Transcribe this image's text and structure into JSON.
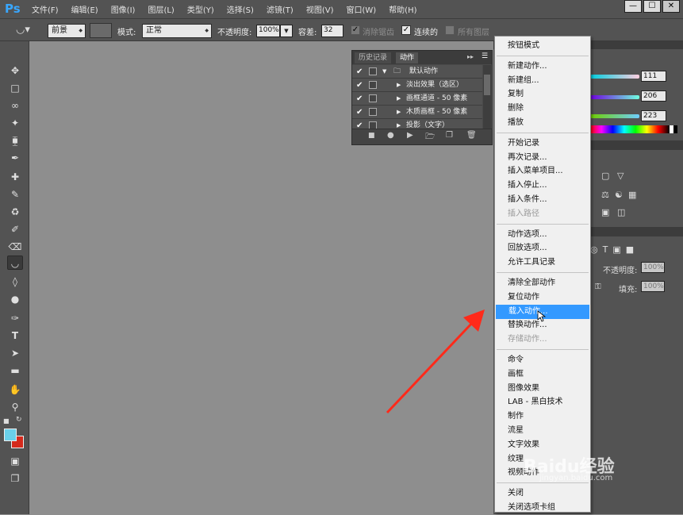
{
  "app": {
    "logo": "Ps"
  },
  "menubar": {
    "items": [
      "文件(F)",
      "编辑(E)",
      "图像(I)",
      "图层(L)",
      "类型(Y)",
      "选择(S)",
      "滤镜(T)",
      "视图(V)",
      "窗口(W)",
      "帮助(H)"
    ],
    "window_controls": {
      "minimize": "—",
      "restore": "☐",
      "close": "✕"
    }
  },
  "options": {
    "fill_source": "前景",
    "mode_label": "模式:",
    "mode_value": "正常",
    "opacity_label": "不透明度:",
    "opacity_value": "100%",
    "tolerance_label": "容差:",
    "tolerance_value": "32",
    "anti_alias_label": "消除锯齿",
    "contiguous_label": "连续的",
    "all_layers_label": "所有图层"
  },
  "actions_panel": {
    "tab_history": "历史记录",
    "tab_actions": "动作",
    "rows": [
      {
        "label": "默认动作",
        "checked": "✔",
        "level": 0
      },
      {
        "label": "淡出效果（选区）",
        "checked": "✔",
        "level": 1
      },
      {
        "label": "画框通道 - 50 像素",
        "checked": "✔",
        "level": 1
      },
      {
        "label": "木质画框 - 50 像素",
        "checked": "✔",
        "level": 1
      },
      {
        "label": "投影（文字）",
        "checked": "✔",
        "level": 1
      }
    ]
  },
  "right_panels": {
    "color_values": [
      "111",
      "206",
      "223"
    ],
    "layers_opacity_label": "不透明度:",
    "layers_opacity_value": "100%",
    "fill_label": "填充:",
    "fill_value": "100%"
  },
  "context_menu": {
    "groups": [
      [
        {
          "label": "按钮模式",
          "state": "normal"
        }
      ],
      [
        {
          "label": "新建动作...",
          "state": "normal"
        },
        {
          "label": "新建组...",
          "state": "normal"
        },
        {
          "label": "复制",
          "state": "normal"
        },
        {
          "label": "删除",
          "state": "normal"
        },
        {
          "label": "播放",
          "state": "normal"
        }
      ],
      [
        {
          "label": "开始记录",
          "state": "normal"
        },
        {
          "label": "再次记录...",
          "state": "normal"
        },
        {
          "label": "插入菜单项目...",
          "state": "normal"
        },
        {
          "label": "插入停止...",
          "state": "normal"
        },
        {
          "label": "插入条件...",
          "state": "normal"
        },
        {
          "label": "插入路径",
          "state": "disabled"
        }
      ],
      [
        {
          "label": "动作选项...",
          "state": "normal"
        },
        {
          "label": "回放选项...",
          "state": "normal"
        },
        {
          "label": "允许工具记录",
          "state": "normal"
        }
      ],
      [
        {
          "label": "清除全部动作",
          "state": "normal"
        },
        {
          "label": "复位动作",
          "state": "normal"
        },
        {
          "label": "载入动作...",
          "state": "highlighted"
        },
        {
          "label": "替换动作...",
          "state": "normal"
        },
        {
          "label": "存储动作...",
          "state": "disabled"
        }
      ],
      [
        {
          "label": "命令",
          "state": "normal"
        },
        {
          "label": "画框",
          "state": "normal"
        },
        {
          "label": "图像效果",
          "state": "normal"
        },
        {
          "label": "LAB - 黑白技术",
          "state": "normal"
        },
        {
          "label": "制作",
          "state": "normal"
        },
        {
          "label": "流星",
          "state": "normal"
        },
        {
          "label": "文字效果",
          "state": "normal"
        },
        {
          "label": "纹理",
          "state": "normal"
        },
        {
          "label": "视频动作",
          "state": "normal"
        }
      ],
      [
        {
          "label": "关闭",
          "state": "normal"
        },
        {
          "label": "关闭选项卡组",
          "state": "normal"
        }
      ]
    ]
  },
  "watermark": {
    "text": "Baidu经验",
    "sub": "jingyan.baidu.com"
  },
  "colors": {
    "highlight": "#3399ff",
    "arrow": "#ff2a1a",
    "foreground": "#6ad0ea",
    "background": "#d42a1c"
  }
}
